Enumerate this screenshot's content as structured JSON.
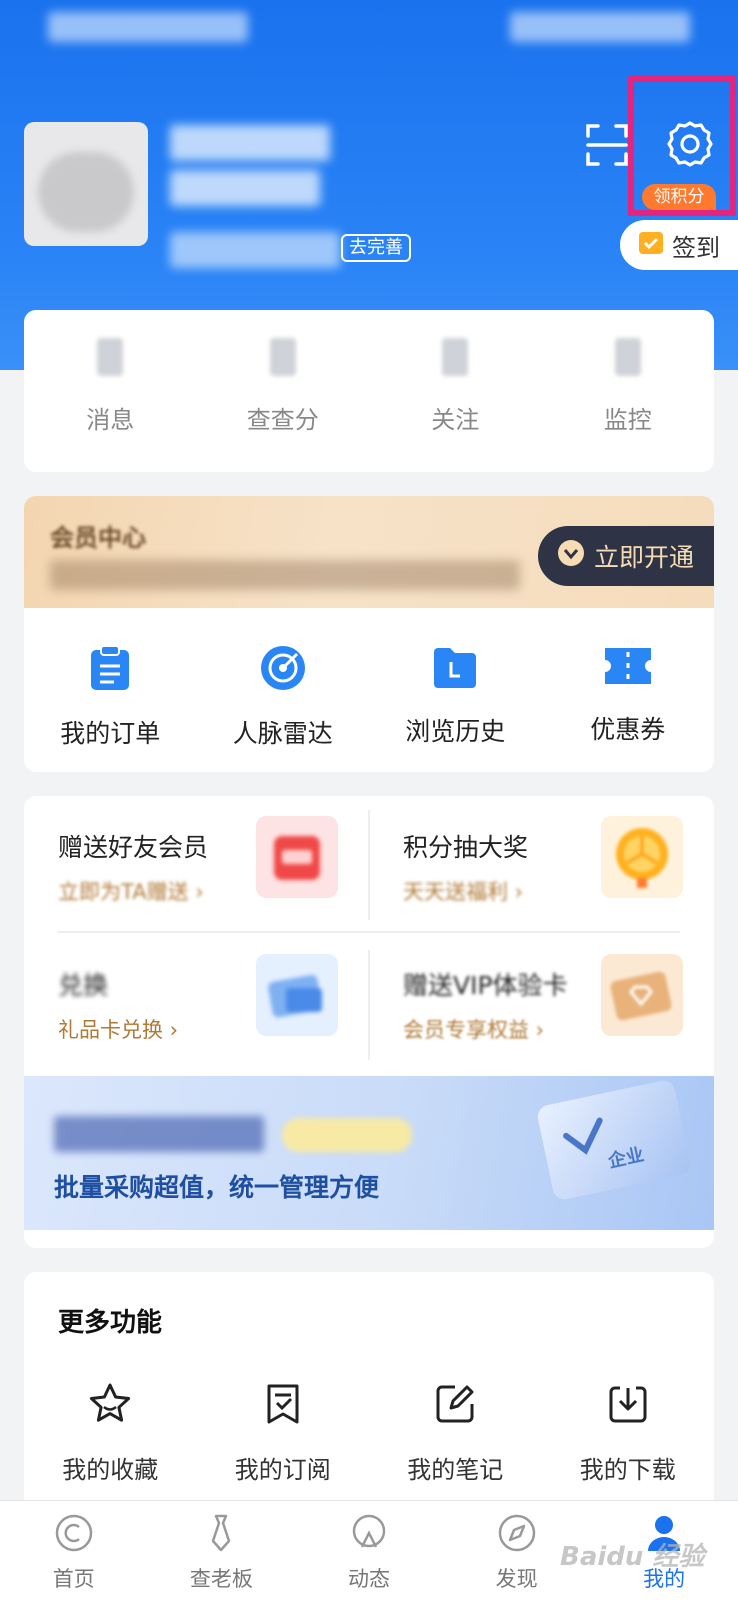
{
  "header": {
    "profile_status_badge": "去完善",
    "points_badge": "领积分",
    "checkin_label": "签到"
  },
  "quick_actions": [
    {
      "label": "消息"
    },
    {
      "label": "查查分"
    },
    {
      "label": "关注"
    },
    {
      "label": "监控"
    }
  ],
  "vip": {
    "title": "会员中心",
    "open_button": "立即开通",
    "items": [
      {
        "label": "我的订单",
        "icon": "clipboard-icon"
      },
      {
        "label": "人脉雷达",
        "icon": "radar-icon"
      },
      {
        "label": "浏览历史",
        "icon": "folder-icon"
      },
      {
        "label": "优惠券",
        "icon": "ticket-icon"
      }
    ]
  },
  "gifts": [
    {
      "title": "赠送好友会员",
      "subtitle": "立即为TA赠送 ›"
    },
    {
      "title": "积分抽大奖",
      "subtitle": "天天送福利 ›"
    },
    {
      "title": "兑换",
      "subtitle": "礼品卡兑换 ›"
    },
    {
      "title": "赠送VIP体验卡",
      "subtitle": "会员专享权益 ›"
    }
  ],
  "enterprise": {
    "subtitle": "批量采购超值，统一管理方便",
    "card_text": "企业"
  },
  "more": {
    "title": "更多功能",
    "items": [
      {
        "label": "我的收藏",
        "icon": "star-icon"
      },
      {
        "label": "我的订阅",
        "icon": "bookmark-check-icon"
      },
      {
        "label": "我的笔记",
        "icon": "edit-icon"
      },
      {
        "label": "我的下载",
        "icon": "download-icon"
      }
    ]
  },
  "tabbar": [
    {
      "label": "首页",
      "icon": "home-icon"
    },
    {
      "label": "查老板",
      "icon": "tie-icon"
    },
    {
      "label": "动态",
      "icon": "feed-icon"
    },
    {
      "label": "发现",
      "icon": "compass-icon"
    },
    {
      "label": "我的",
      "icon": "user-icon",
      "active": true
    }
  ],
  "watermark": "Baidu 经验",
  "colors": {
    "primary": "#1a72ee",
    "highlight": "#e5247e",
    "accent_orange": "#ff7a2e",
    "gold_text": "#b07a35"
  }
}
